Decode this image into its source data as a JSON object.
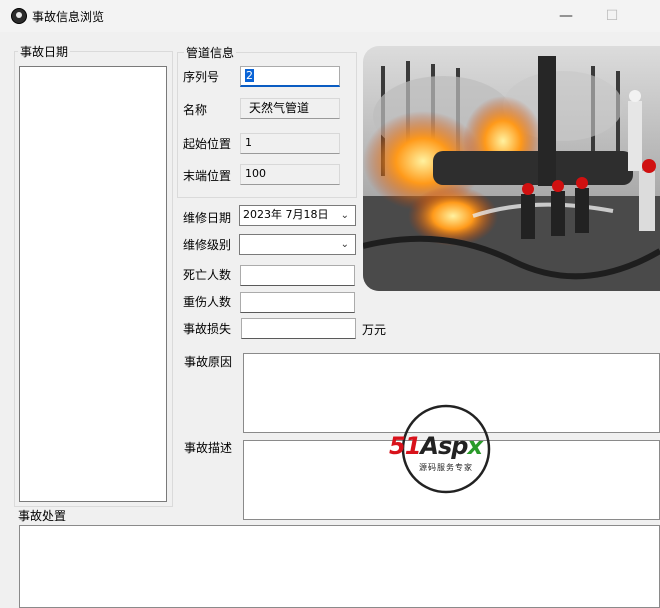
{
  "window": {
    "title": "事故信息浏览",
    "minimize": "—",
    "maximize": "☐",
    "close": "✕"
  },
  "date_group": {
    "title": "事故日期"
  },
  "pipe_group": {
    "title": "管道信息",
    "fields": [
      {
        "label": "序列号",
        "value": "2"
      },
      {
        "label": "名称",
        "value": "天然气管道"
      },
      {
        "label": "起始位置",
        "value": "1"
      },
      {
        "label": "末端位置",
        "value": "100"
      }
    ]
  },
  "repair_date": {
    "label": "维修日期",
    "value": "2023年  7月18日"
  },
  "repair_level": {
    "label": "维修级别",
    "value": ""
  },
  "deaths": {
    "label": "死亡人数",
    "value": ""
  },
  "injuries": {
    "label": "重伤人数",
    "value": ""
  },
  "loss": {
    "label": "事故损失",
    "value": "",
    "unit": "万元"
  },
  "cause": {
    "label": "事故原因"
  },
  "description": {
    "label": "事故描述"
  },
  "handling": {
    "label": "事故处置"
  },
  "watermark": {
    "brand": "51Aspx",
    "tagline": "源码服务专家"
  }
}
